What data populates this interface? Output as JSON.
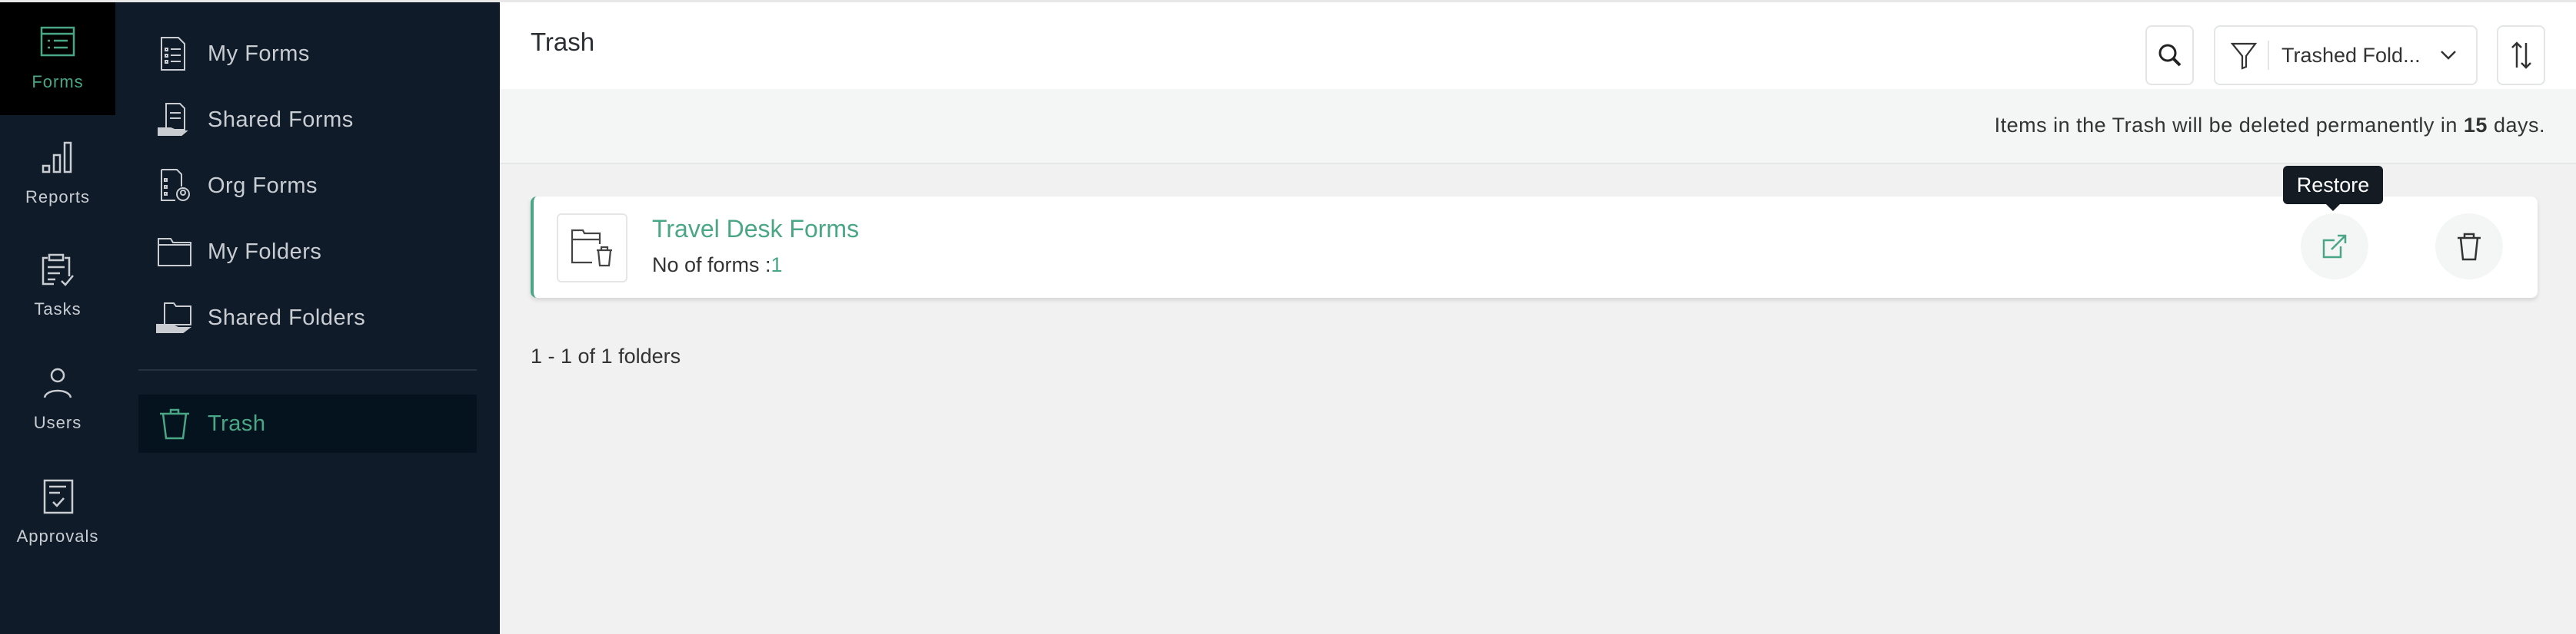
{
  "rail": [
    {
      "label": "Forms",
      "icon": "forms-icon",
      "active": true
    },
    {
      "label": "Reports",
      "icon": "reports-icon"
    },
    {
      "label": "Tasks",
      "icon": "tasks-icon"
    },
    {
      "label": "Users",
      "icon": "users-icon"
    },
    {
      "label": "Approvals",
      "icon": "approvals-icon"
    }
  ],
  "sidebar": {
    "items": [
      {
        "label": "My Forms",
        "icon": "form-document-icon"
      },
      {
        "label": "Shared Forms",
        "icon": "shared-forms-icon"
      },
      {
        "label": "Org Forms",
        "icon": "org-forms-icon"
      },
      {
        "label": "My Folders",
        "icon": "folder-icon"
      },
      {
        "label": "Shared Folders",
        "icon": "shared-folder-icon"
      }
    ],
    "trash": {
      "label": "Trash",
      "icon": "trash-icon",
      "active": true
    }
  },
  "header": {
    "title": "Trash",
    "filter_value": "Trashed Fold...",
    "search_icon": "search-icon",
    "filter_icon": "funnel-icon",
    "sort_icon": "sort-icon"
  },
  "notice": {
    "prefix": "Items in the Trash will be deleted permanently in ",
    "days": "15",
    "suffix": " days."
  },
  "folders": [
    {
      "name": "Travel Desk Forms",
      "count_label": "No of forms :",
      "count": "1"
    }
  ],
  "tooltip": "Restore",
  "pagination": "1 - 1 of 1 folders",
  "colors": {
    "accent": "#4aa785",
    "sidebar": "#0f1b29"
  }
}
